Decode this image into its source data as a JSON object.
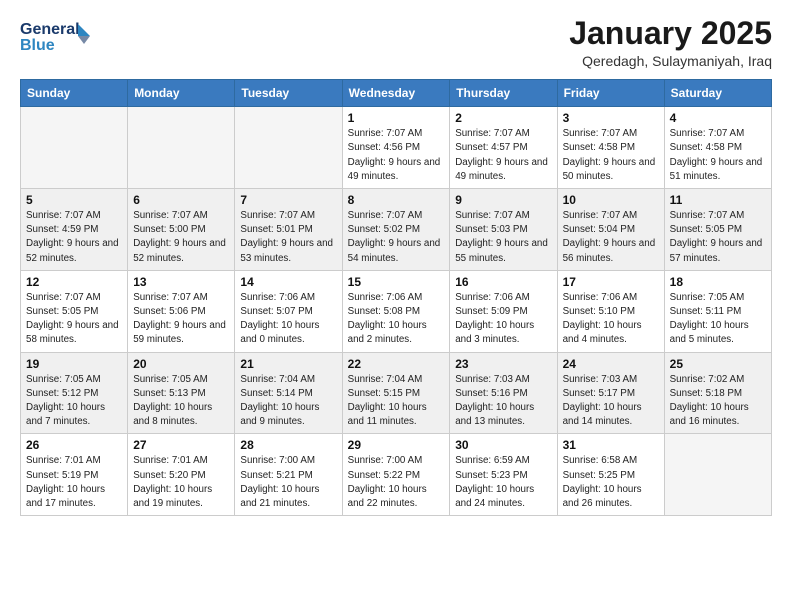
{
  "header": {
    "logo_line1": "General",
    "logo_line2": "Blue",
    "month": "January 2025",
    "location": "Qeredagh, Sulaymaniyah, Iraq"
  },
  "days_of_week": [
    "Sunday",
    "Monday",
    "Tuesday",
    "Wednesday",
    "Thursday",
    "Friday",
    "Saturday"
  ],
  "weeks": [
    [
      {
        "num": "",
        "sunrise": "",
        "sunset": "",
        "daylight": "",
        "empty": true
      },
      {
        "num": "",
        "sunrise": "",
        "sunset": "",
        "daylight": "",
        "empty": true
      },
      {
        "num": "",
        "sunrise": "",
        "sunset": "",
        "daylight": "",
        "empty": true
      },
      {
        "num": "1",
        "sunrise": "7:07 AM",
        "sunset": "4:56 PM",
        "daylight": "9 hours and 49 minutes."
      },
      {
        "num": "2",
        "sunrise": "7:07 AM",
        "sunset": "4:57 PM",
        "daylight": "9 hours and 49 minutes."
      },
      {
        "num": "3",
        "sunrise": "7:07 AM",
        "sunset": "4:58 PM",
        "daylight": "9 hours and 50 minutes."
      },
      {
        "num": "4",
        "sunrise": "7:07 AM",
        "sunset": "4:58 PM",
        "daylight": "9 hours and 51 minutes."
      }
    ],
    [
      {
        "num": "5",
        "sunrise": "7:07 AM",
        "sunset": "4:59 PM",
        "daylight": "9 hours and 52 minutes."
      },
      {
        "num": "6",
        "sunrise": "7:07 AM",
        "sunset": "5:00 PM",
        "daylight": "9 hours and 52 minutes."
      },
      {
        "num": "7",
        "sunrise": "7:07 AM",
        "sunset": "5:01 PM",
        "daylight": "9 hours and 53 minutes."
      },
      {
        "num": "8",
        "sunrise": "7:07 AM",
        "sunset": "5:02 PM",
        "daylight": "9 hours and 54 minutes."
      },
      {
        "num": "9",
        "sunrise": "7:07 AM",
        "sunset": "5:03 PM",
        "daylight": "9 hours and 55 minutes."
      },
      {
        "num": "10",
        "sunrise": "7:07 AM",
        "sunset": "5:04 PM",
        "daylight": "9 hours and 56 minutes."
      },
      {
        "num": "11",
        "sunrise": "7:07 AM",
        "sunset": "5:05 PM",
        "daylight": "9 hours and 57 minutes."
      }
    ],
    [
      {
        "num": "12",
        "sunrise": "7:07 AM",
        "sunset": "5:05 PM",
        "daylight": "9 hours and 58 minutes."
      },
      {
        "num": "13",
        "sunrise": "7:07 AM",
        "sunset": "5:06 PM",
        "daylight": "9 hours and 59 minutes."
      },
      {
        "num": "14",
        "sunrise": "7:06 AM",
        "sunset": "5:07 PM",
        "daylight": "10 hours and 0 minutes."
      },
      {
        "num": "15",
        "sunrise": "7:06 AM",
        "sunset": "5:08 PM",
        "daylight": "10 hours and 2 minutes."
      },
      {
        "num": "16",
        "sunrise": "7:06 AM",
        "sunset": "5:09 PM",
        "daylight": "10 hours and 3 minutes."
      },
      {
        "num": "17",
        "sunrise": "7:06 AM",
        "sunset": "5:10 PM",
        "daylight": "10 hours and 4 minutes."
      },
      {
        "num": "18",
        "sunrise": "7:05 AM",
        "sunset": "5:11 PM",
        "daylight": "10 hours and 5 minutes."
      }
    ],
    [
      {
        "num": "19",
        "sunrise": "7:05 AM",
        "sunset": "5:12 PM",
        "daylight": "10 hours and 7 minutes."
      },
      {
        "num": "20",
        "sunrise": "7:05 AM",
        "sunset": "5:13 PM",
        "daylight": "10 hours and 8 minutes."
      },
      {
        "num": "21",
        "sunrise": "7:04 AM",
        "sunset": "5:14 PM",
        "daylight": "10 hours and 9 minutes."
      },
      {
        "num": "22",
        "sunrise": "7:04 AM",
        "sunset": "5:15 PM",
        "daylight": "10 hours and 11 minutes."
      },
      {
        "num": "23",
        "sunrise": "7:03 AM",
        "sunset": "5:16 PM",
        "daylight": "10 hours and 13 minutes."
      },
      {
        "num": "24",
        "sunrise": "7:03 AM",
        "sunset": "5:17 PM",
        "daylight": "10 hours and 14 minutes."
      },
      {
        "num": "25",
        "sunrise": "7:02 AM",
        "sunset": "5:18 PM",
        "daylight": "10 hours and 16 minutes."
      }
    ],
    [
      {
        "num": "26",
        "sunrise": "7:01 AM",
        "sunset": "5:19 PM",
        "daylight": "10 hours and 17 minutes."
      },
      {
        "num": "27",
        "sunrise": "7:01 AM",
        "sunset": "5:20 PM",
        "daylight": "10 hours and 19 minutes."
      },
      {
        "num": "28",
        "sunrise": "7:00 AM",
        "sunset": "5:21 PM",
        "daylight": "10 hours and 21 minutes."
      },
      {
        "num": "29",
        "sunrise": "7:00 AM",
        "sunset": "5:22 PM",
        "daylight": "10 hours and 22 minutes."
      },
      {
        "num": "30",
        "sunrise": "6:59 AM",
        "sunset": "5:23 PM",
        "daylight": "10 hours and 24 minutes."
      },
      {
        "num": "31",
        "sunrise": "6:58 AM",
        "sunset": "5:25 PM",
        "daylight": "10 hours and 26 minutes."
      },
      {
        "num": "",
        "sunrise": "",
        "sunset": "",
        "daylight": "",
        "empty": true
      }
    ]
  ]
}
